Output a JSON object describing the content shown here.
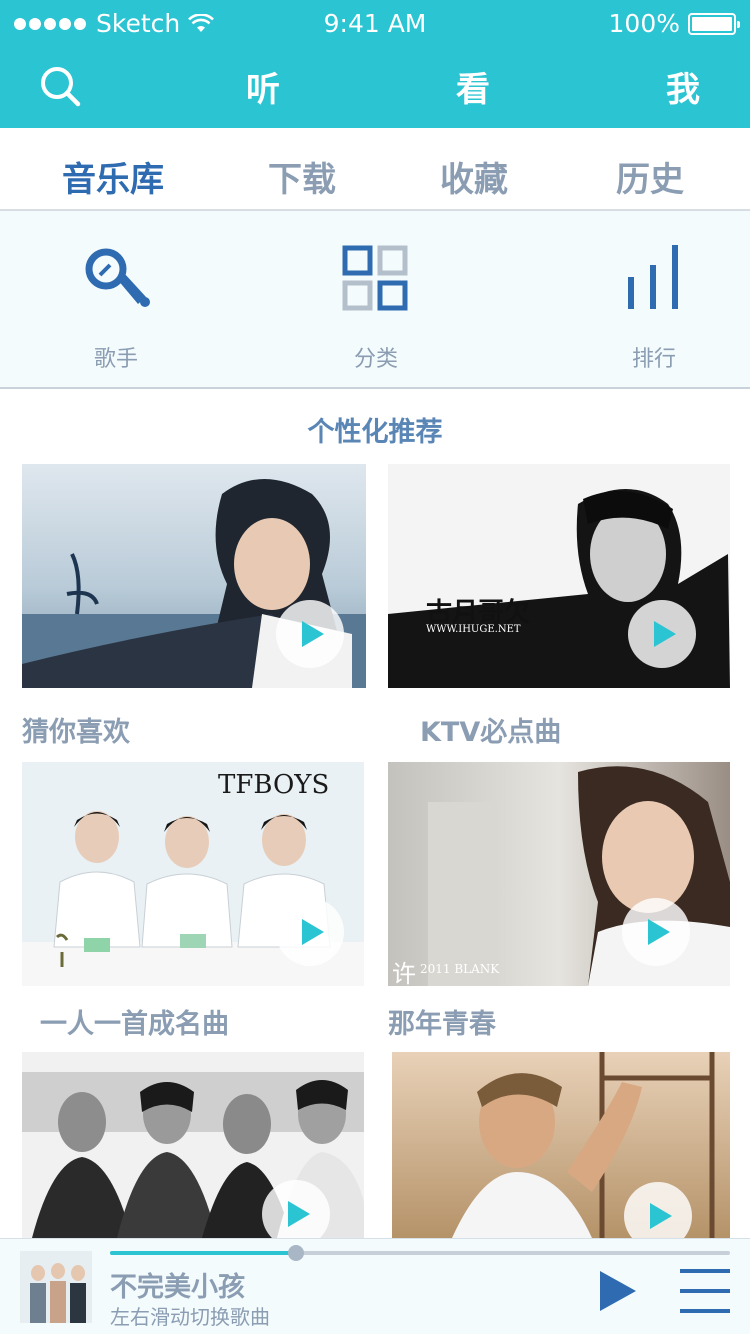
{
  "status_bar": {
    "carrier": "Sketch",
    "time": "9:41 AM",
    "battery": "100%"
  },
  "top_nav": {
    "tabs": [
      "听",
      "看",
      "我"
    ]
  },
  "sub_tabs": [
    "音乐库",
    "下载",
    "收藏",
    "历史"
  ],
  "categories": [
    {
      "label": "歌手",
      "icon": "microphone-icon"
    },
    {
      "label": "分类",
      "icon": "grid-icon"
    },
    {
      "label": "排行",
      "icon": "ranking-bars-icon"
    }
  ],
  "recommend": {
    "title": "个性化推荐",
    "items": [
      {
        "caption": "猜你喜欢"
      },
      {
        "caption": "KTV必点曲",
        "overlay": "古月哥欠",
        "overlay_sub": "WWW.IHUGE.NET"
      },
      {
        "caption": "一人一首成名曲",
        "overlay": "TFBOYS"
      },
      {
        "caption": "那年青春",
        "overlay": "许",
        "overlay_sub": "2011 BLANK"
      },
      {
        "caption": ""
      },
      {
        "caption": ""
      }
    ]
  },
  "player": {
    "song": "不完美小孩",
    "hint": "左右滑动切换歌曲",
    "progress": 0.3
  },
  "colors": {
    "accent": "#2ac4d2",
    "active_tab": "#2f6bb0",
    "muted": "#8b9db2"
  }
}
